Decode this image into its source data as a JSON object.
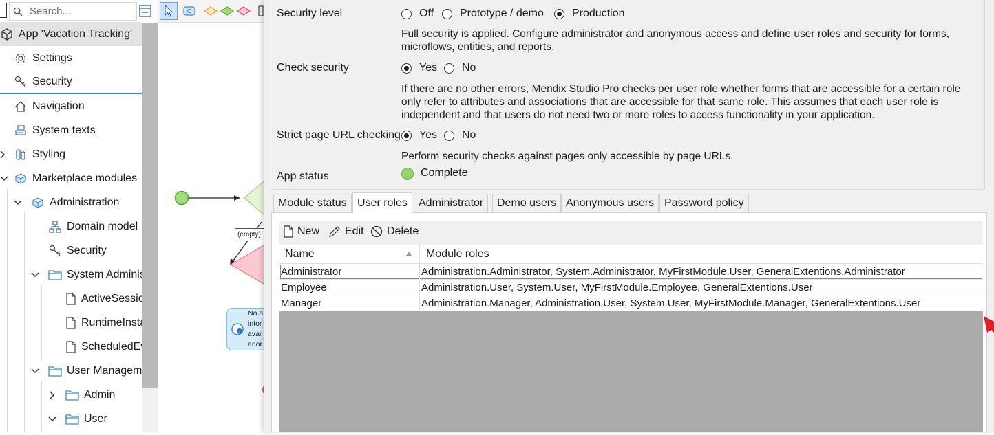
{
  "sidebar": {
    "search_placeholder": "Search...",
    "items": [
      {
        "label": "App 'Vacation Tracking'"
      },
      {
        "label": "Settings"
      },
      {
        "label": "Security"
      },
      {
        "label": "Navigation"
      },
      {
        "label": "System texts"
      },
      {
        "label": "Styling"
      },
      {
        "label": "Marketplace modules"
      },
      {
        "label": "Administration"
      },
      {
        "label": "Domain model"
      },
      {
        "label": "Security"
      },
      {
        "label": "System Administration"
      },
      {
        "label": "ActiveSessions"
      },
      {
        "label": "RuntimeInstances"
      },
      {
        "label": "ScheduledEvents"
      },
      {
        "label": "User Management"
      },
      {
        "label": "Admin"
      },
      {
        "label": "User"
      }
    ]
  },
  "canvas": {
    "empty_label": "(empty)",
    "annotation_text": "No a\ninfor\navail\nanor"
  },
  "security": {
    "security_level": {
      "label": "Security level",
      "options": [
        "Off",
        "Prototype / demo",
        "Production"
      ],
      "selected": "Production",
      "description": "Full security is applied. Configure administrator and anonymous access and define user roles and security for forms, microflows, entities, and reports."
    },
    "check_security": {
      "label": "Check security",
      "options": [
        "Yes",
        "No"
      ],
      "selected": "Yes",
      "description": "If there are no other errors, Mendix Studio Pro checks per user role whether forms that are accessible for a certain role only refer to attributes and associations that are accessible for that same role. This assumes that each user role is independent and that users do not need two or more roles to access functionality in your application."
    },
    "strict_url": {
      "label": "Strict page URL checking",
      "options": [
        "Yes",
        "No"
      ],
      "selected": "Yes",
      "description": "Perform security checks against pages only accessible by page URLs."
    },
    "app_status": {
      "label": "App status",
      "value": "Complete",
      "color": "#9ad26b"
    }
  },
  "tabs": [
    "Module status",
    "User roles",
    "Administrator",
    "Demo users",
    "Anonymous users",
    "Password policy"
  ],
  "active_tab": "User roles",
  "toolbar": {
    "new": "New",
    "edit": "Edit",
    "delete": "Delete"
  },
  "grid": {
    "columns": [
      "Name",
      "Module roles"
    ],
    "rows": [
      {
        "name": "Administrator",
        "roles": "Administration.Administrator, System.Administrator, MyFirstModule.User, GeneralExtentions.Administrator"
      },
      {
        "name": "Employee",
        "roles": "Administration.User, System.User, MyFirstModule.Employee, GeneralExtentions.User"
      },
      {
        "name": "Manager",
        "roles": "Administration.Manager, Administration.User, System.User, MyFirstModule.Manager, GeneralExtentions.User"
      }
    ]
  },
  "colors": {
    "accent_arrow": "#e02020",
    "selection": "#3b7dd8"
  }
}
